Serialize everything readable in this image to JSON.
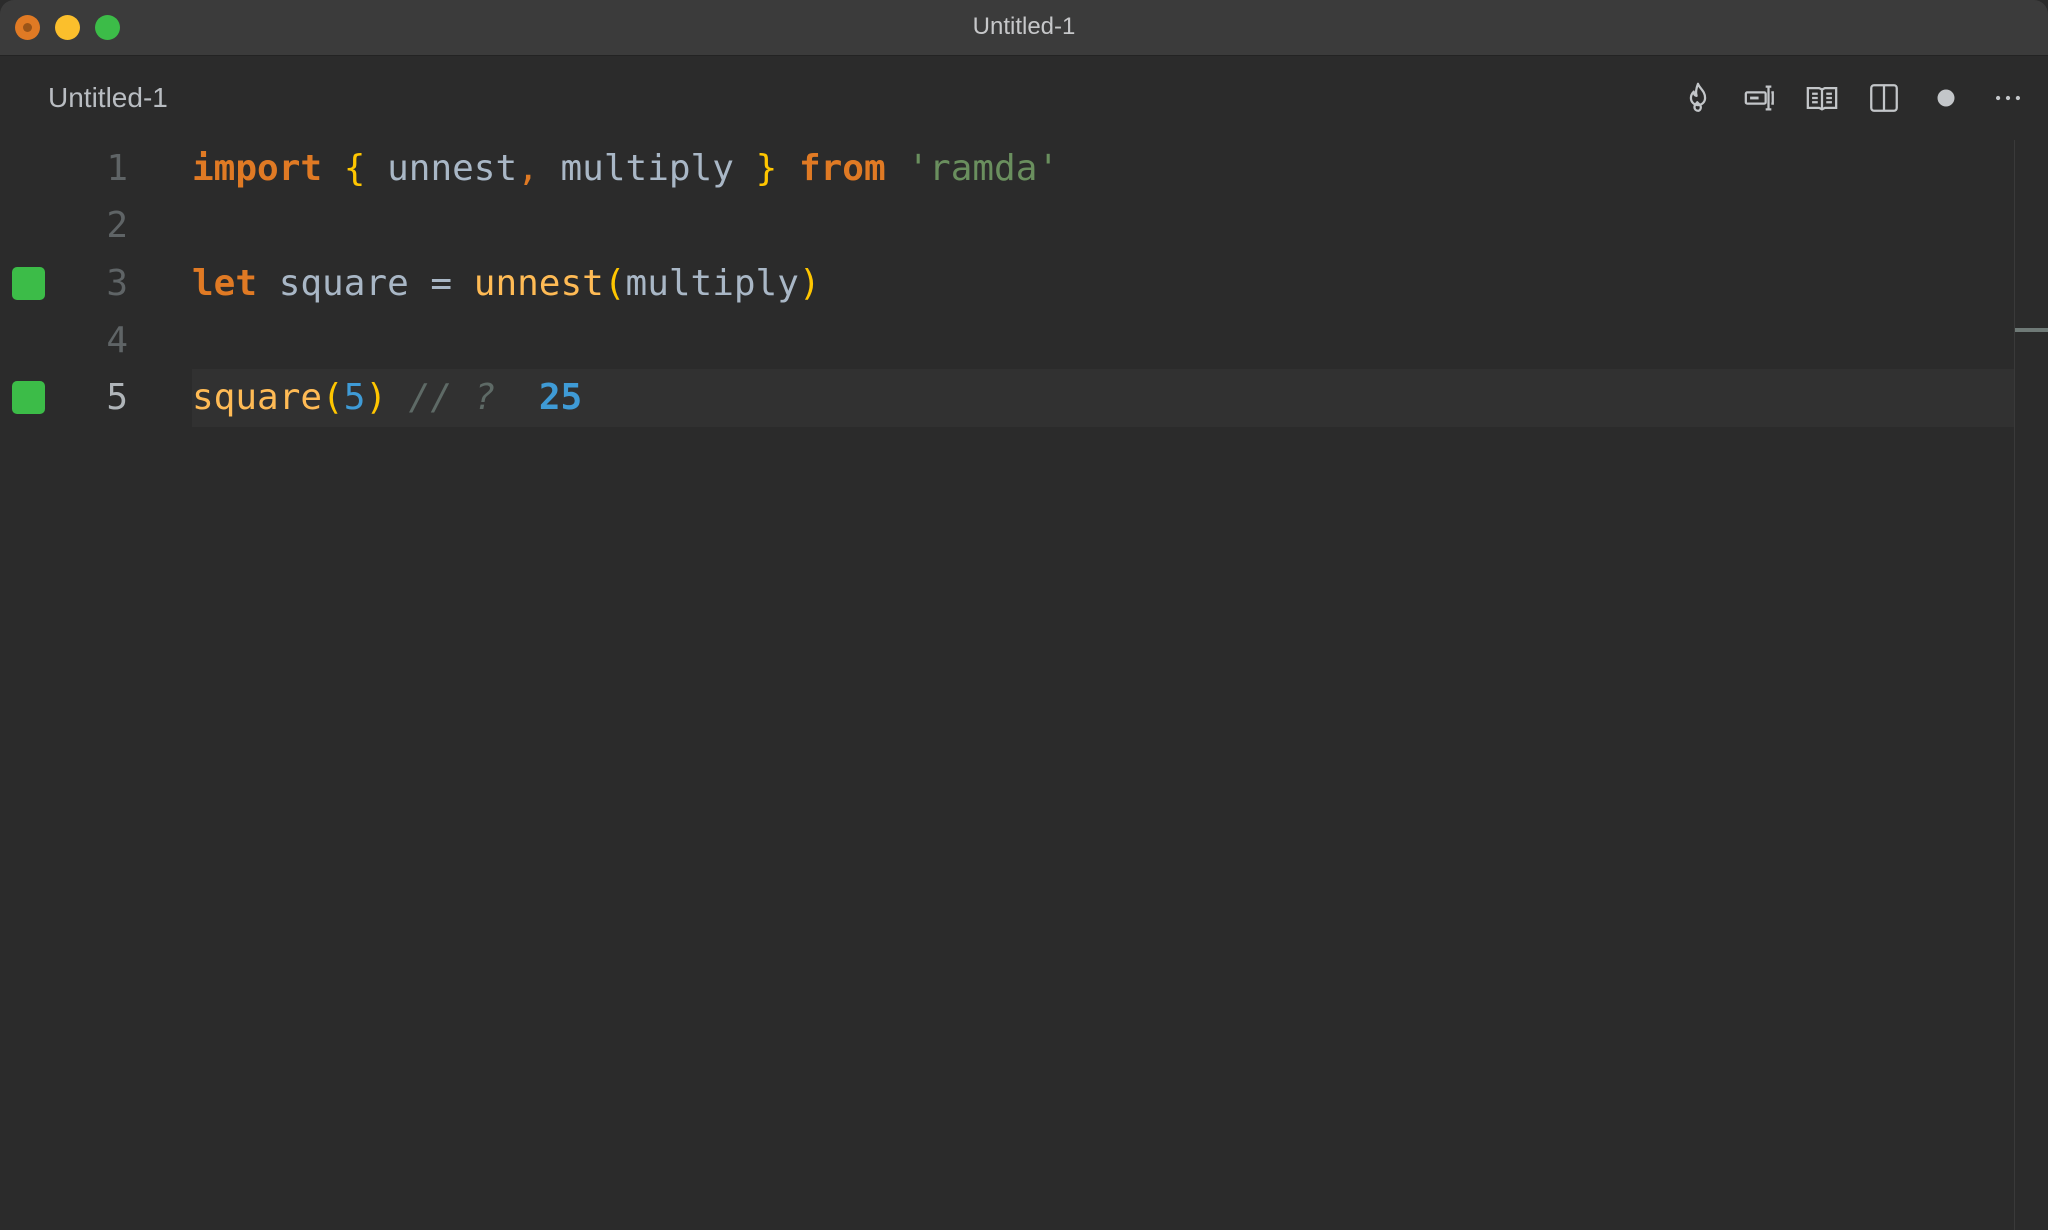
{
  "window": {
    "title": "Untitled-1",
    "traffic_lights": {
      "close": "#e07a24",
      "minimize": "#fbbf2c",
      "zoom": "#3cbc48"
    }
  },
  "tab": {
    "title": "Untitled-1"
  },
  "toolbar": {
    "buttons": [
      {
        "name": "flame-icon",
        "label": "Quokka profiler"
      },
      {
        "name": "inline-input-icon",
        "label": "Toggle inline"
      },
      {
        "name": "book-icon",
        "label": "Open preview"
      },
      {
        "name": "split-editor-icon",
        "label": "Split editor"
      },
      {
        "name": "unsaved-dot-icon",
        "label": "Unsaved changes"
      },
      {
        "name": "more-actions-icon",
        "label": "More actions"
      }
    ]
  },
  "editor": {
    "language": "javascript",
    "current_line": 5,
    "lines": [
      {
        "number": "1",
        "marker": false,
        "tokens": [
          {
            "t": "import",
            "c": "kw"
          },
          {
            "t": " ",
            "c": ""
          },
          {
            "t": "{",
            "c": "brace"
          },
          {
            "t": " unnest",
            "c": "ident"
          },
          {
            "t": ",",
            "c": "comma"
          },
          {
            "t": " multiply ",
            "c": "ident"
          },
          {
            "t": "}",
            "c": "brace"
          },
          {
            "t": " ",
            "c": ""
          },
          {
            "t": "from",
            "c": "kw"
          },
          {
            "t": " ",
            "c": ""
          },
          {
            "t": "'ramda'",
            "c": "str"
          }
        ]
      },
      {
        "number": "2",
        "marker": false,
        "tokens": []
      },
      {
        "number": "3",
        "marker": true,
        "tokens": [
          {
            "t": "let",
            "c": "kw"
          },
          {
            "t": " square = ",
            "c": "ident"
          },
          {
            "t": "unnest",
            "c": "fn"
          },
          {
            "t": "(",
            "c": "brace"
          },
          {
            "t": "multiply",
            "c": "ident"
          },
          {
            "t": ")",
            "c": "brace"
          }
        ]
      },
      {
        "number": "4",
        "marker": false,
        "tokens": []
      },
      {
        "number": "5",
        "marker": true,
        "tokens": [
          {
            "t": "square",
            "c": "fn"
          },
          {
            "t": "(",
            "c": "brace"
          },
          {
            "t": "5",
            "c": "num"
          },
          {
            "t": ")",
            "c": "brace"
          },
          {
            "t": " ",
            "c": ""
          },
          {
            "t": "// ?",
            "c": "cmt"
          },
          {
            "t": "  ",
            "c": ""
          },
          {
            "t": "25",
            "c": "res"
          }
        ]
      }
    ]
  },
  "colors": {
    "background": "#2b2b2b",
    "titlebar": "#3b3b3b",
    "keyword": "#e07a24",
    "brace": "#ffc600",
    "identifier": "#a9b7c6",
    "function": "#ffbb55",
    "string": "#6a8f5e",
    "number": "#3f9bd6",
    "comment": "#5e6a66",
    "coverage_marker": "#3cbc48"
  }
}
